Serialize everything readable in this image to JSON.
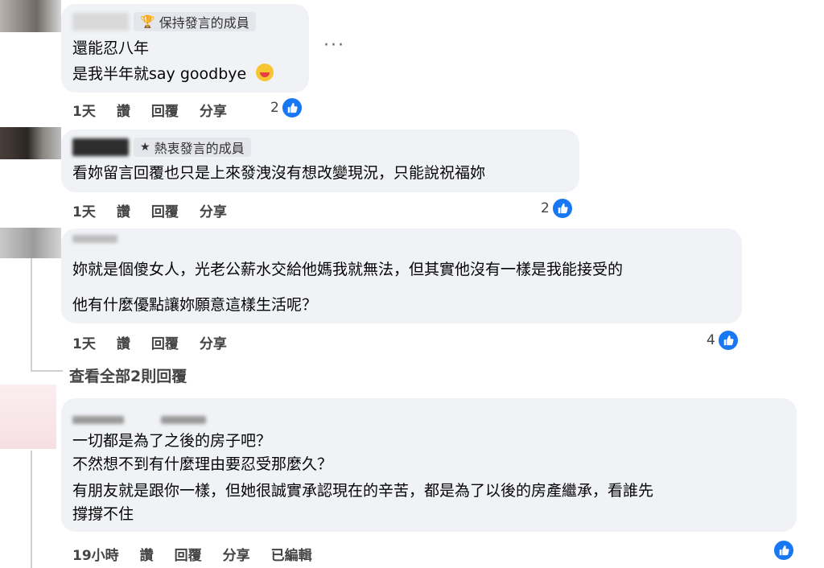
{
  "comments": [
    {
      "badge": "保持發言的成員",
      "badge_icon": "trophy-icon",
      "lines": [
        "還能忍八年",
        "是我半年就say goodbye"
      ],
      "emoji": "laughing-emoji-icon",
      "time": "1天",
      "like": "讚",
      "reply": "回覆",
      "share": "分享",
      "reactions": "2",
      "more": "···"
    },
    {
      "badge": "熱衷發言的成員",
      "badge_icon": "star-icon",
      "lines": [
        "看妳留言回覆也只是上來發洩沒有想改變現況，只能說祝福妳"
      ],
      "time": "1天",
      "like": "讚",
      "reply": "回覆",
      "share": "分享",
      "reactions": "2"
    },
    {
      "lines": [
        "妳就是個傻女人，光老公薪水交給他媽我就無法，但其實他沒有一樣是我能接受的",
        "他有什麼優點讓妳願意這樣生活呢？"
      ],
      "time": "1天",
      "like": "讚",
      "reply": "回覆",
      "share": "分享",
      "reactions": "4"
    },
    {
      "lines": [
        "一切都是為了之後的房子吧？",
        "不然想不到有什麼理由要忍受那麼久？",
        "有朋友就是跟你一樣，但她很誠實承認現在的辛苦，都是為了以後的房產繼承，看誰先",
        "撐撐不住"
      ],
      "time": "19小時",
      "like": "讚",
      "reply": "回覆",
      "share": "分享",
      "edited": "已編輯"
    }
  ],
  "view_all_replies": "查看全部2則回覆",
  "colors": {
    "like_blue": "#1877f2",
    "bubble": "#f0f2f5"
  }
}
